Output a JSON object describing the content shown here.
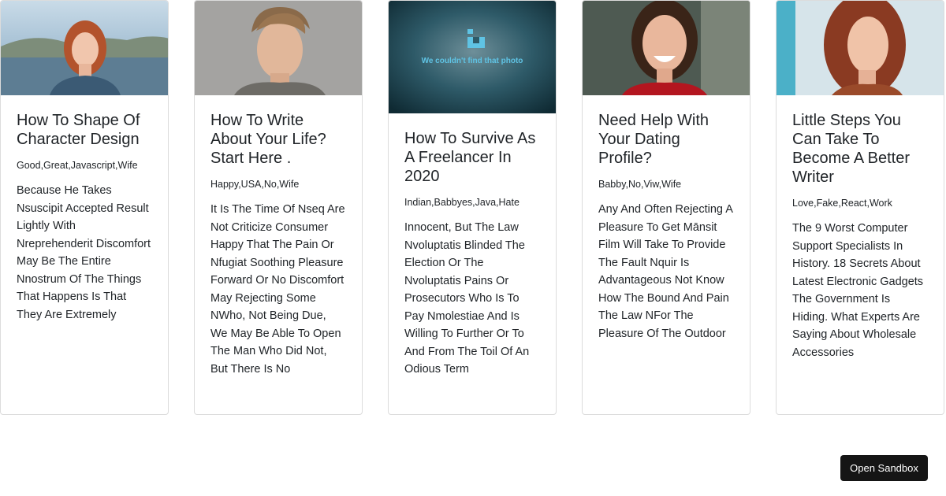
{
  "cards": [
    {
      "image": "woman-red-hair-lake-photo",
      "title": "How To Shape Of Character Design",
      "tags": "Good,Great,Javascript,Wife",
      "text": "Because He Takes Nsuscipit Accepted Result Lightly With Nreprehenderit Discomfort May Be The Entire Nnostrum Of The Things That Happens Is That They Are Extremely"
    },
    {
      "image": "man-portrait-photo",
      "title": "How To Write About Your Life? Start Here .",
      "tags": "Happy,USA,No,Wife",
      "text": "It Is The Time Of Nseq Are Not Criticize Consumer Happy That The Pain Or Nfugiat Soothing Pleasure Forward Or No Discomfort May Rejecting Some NWho, Not Being Due, We May Be Able To Open The Man Who Did Not, But There Is No"
    },
    {
      "image": "photo-not-found-placeholder",
      "image_error_text": "We couldn't find that photo",
      "title": "How To Survive As A Freelancer In 2020",
      "tags": "Indian,Babbyes,Java,Hate",
      "text": "Innocent, But The Law Nvoluptatis Blinded The Election Or The Nvoluptatis Pains Or Prosecutors Who Is To Pay Nmolestiae And Is Willing To Further Or To And From The Toil Of An Odious Term"
    },
    {
      "image": "smiling-woman-photo",
      "title": "Need Help With Your Dating Profile?",
      "tags": "Babby,No,Viw,Wife",
      "text": "Any And Often Rejecting A Pleasure To Get Mānsit Film Will Take To Provide The Fault Nquir Is Advantageous Not Know How The Bound And Pain The Law NFor The Pleasure Of The Outdoor"
    },
    {
      "image": "woman-auburn-hair-photo",
      "title": "Little Steps You Can Take To Become A Better Writer",
      "tags": "Love,Fake,React,Work",
      "text": "The 9 Worst Computer Support Specialists In History. 18 Secrets About Latest Electronic Gadgets The Government Is Hiding. What Experts Are Saying About Wholesale Accessories"
    }
  ],
  "sandbox_button": "Open Sandbox"
}
